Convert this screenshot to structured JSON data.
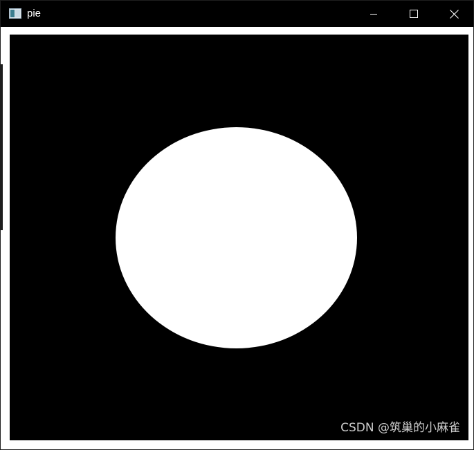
{
  "window": {
    "title": "pie",
    "app_icon": "app-window-icon",
    "controls": {
      "minimize_icon": "minimize-icon",
      "maximize_icon": "maximize-icon",
      "close_icon": "close-icon"
    }
  },
  "canvas": {
    "background_color": "#000000",
    "shape": "white-filled-ellipse",
    "shape_color": "#ffffff"
  },
  "watermark": {
    "text": "CSDN @筑巢的小麻雀"
  }
}
